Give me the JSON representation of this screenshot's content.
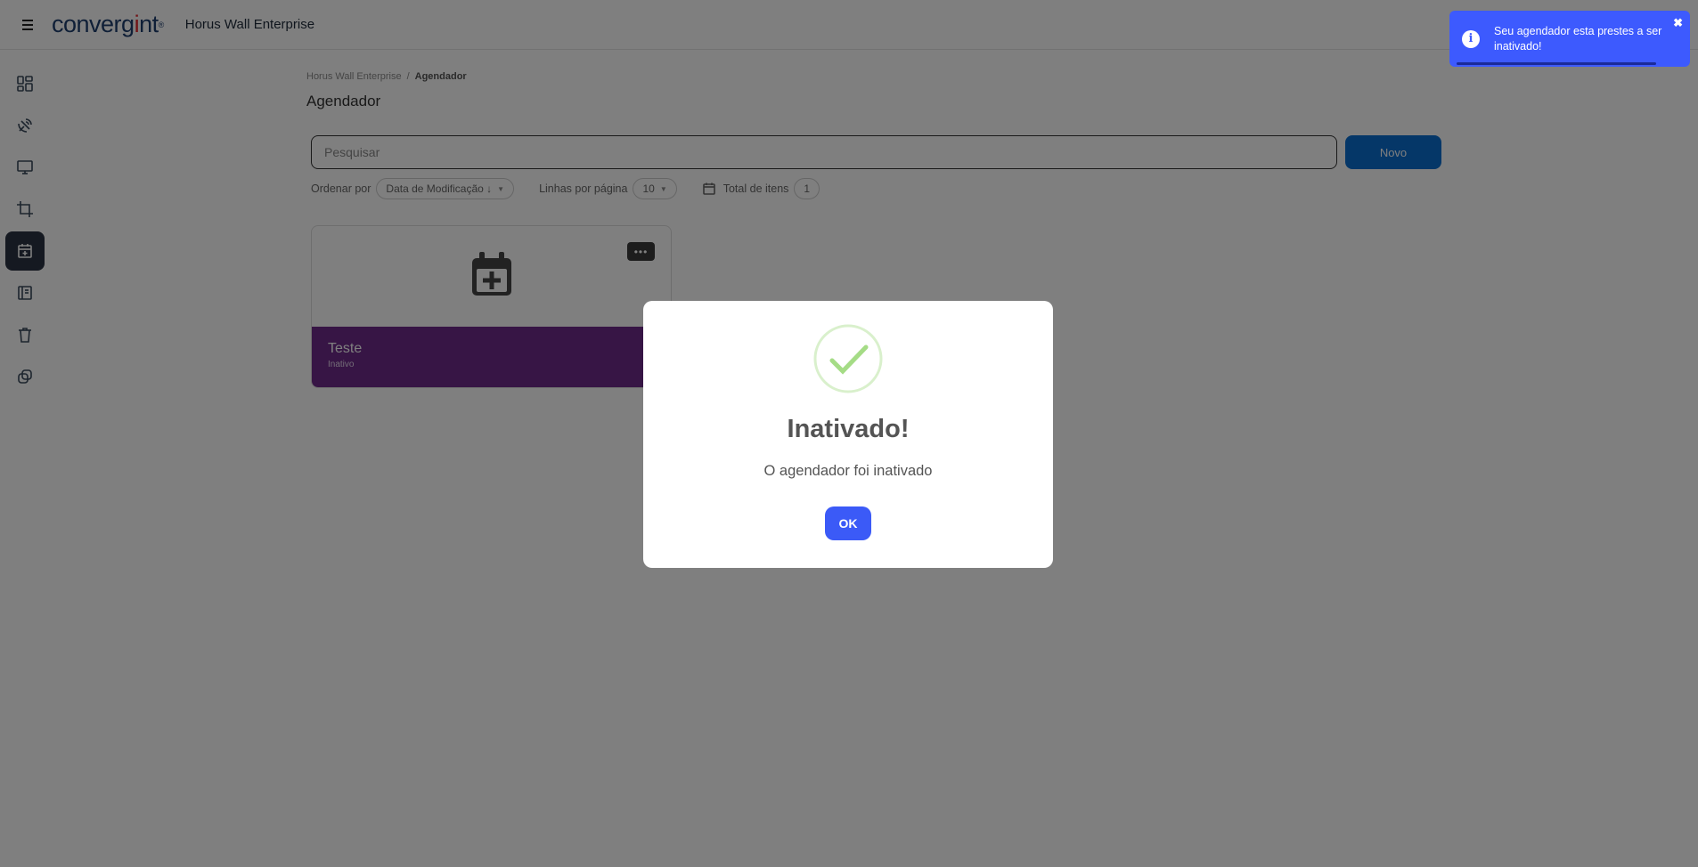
{
  "header": {
    "logo_text_pre": "converg",
    "logo_text_i": "i",
    "logo_text_post": "nt",
    "logo_tm": "®",
    "app_title": "Horus Wall Enterprise"
  },
  "sidebar": {
    "items": [
      {
        "icon": "dashboard-icon",
        "active": false
      },
      {
        "icon": "satellite-dish-icon",
        "active": false
      },
      {
        "icon": "monitor-icon",
        "active": false
      },
      {
        "icon": "crop-icon",
        "active": false
      },
      {
        "icon": "calendar-plus-icon",
        "active": true
      },
      {
        "icon": "book-icon",
        "active": false
      },
      {
        "icon": "trash-icon",
        "active": false
      },
      {
        "icon": "copy-icon",
        "active": false
      }
    ]
  },
  "breadcrumb": {
    "root": "Horus Wall Enterprise",
    "separator": "/",
    "current": "Agendador"
  },
  "page_title": "Agendador",
  "search": {
    "placeholder": "Pesquisar",
    "value": ""
  },
  "new_button": "Novo",
  "filters": {
    "sort_label": "Ordenar por",
    "sort_value": "Data de Modificação ↓",
    "rows_label": "Linhas por página",
    "rows_value": "10",
    "total_label": "Total de itens",
    "total_value": "1"
  },
  "cards": [
    {
      "name": "Teste",
      "status": "Inativo",
      "more": "•••"
    }
  ],
  "toast": {
    "message": "Seu agendador esta prestes a ser inativado!",
    "close": "✖",
    "progress": 0.88
  },
  "modal": {
    "title": "Inativado!",
    "text": "O agendador foi inativado",
    "ok": "OK"
  },
  "colors": {
    "primary": "#0a6ed1",
    "card_bottom": "#6e2a8a",
    "toast": "#3d5afe",
    "ok_button": "#3b5af7",
    "success": "#a5dc86"
  }
}
